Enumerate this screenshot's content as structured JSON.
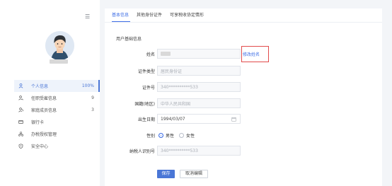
{
  "sidebar": {
    "items": [
      {
        "icon": "user-icon",
        "label": "个人信息",
        "count": "100%",
        "active": true
      },
      {
        "icon": "work-user-icon",
        "label": "任职受雇信息",
        "count": "9"
      },
      {
        "icon": "family-user-icon",
        "label": "家庭成员信息",
        "count": "3"
      },
      {
        "icon": "bank-card-icon",
        "label": "银行卡"
      },
      {
        "icon": "authorization-icon",
        "label": "办税授权管理"
      },
      {
        "icon": "security-shield-icon",
        "label": "安全中心"
      }
    ]
  },
  "tabs": [
    {
      "label": "基本信息",
      "active": true
    },
    {
      "label": "其他身份证件"
    },
    {
      "label": "可享税收协定情形"
    }
  ],
  "section_title": "用户基础信息",
  "form": {
    "name": {
      "label": "姓名"
    },
    "document_type": {
      "label": "证件类型",
      "value": "居民身份证"
    },
    "document_number": {
      "label": "证件号",
      "value": "340**********533"
    },
    "nationality": {
      "label": "国籍(地区)",
      "value": "中华人民共和国"
    },
    "birth_date": {
      "label": "出生日期",
      "value": "1994/03/07"
    },
    "gender": {
      "label": "性别",
      "options": [
        "男性",
        "女性"
      ],
      "selected": "男性"
    },
    "taxpayer_id": {
      "label": "纳税人识别号",
      "value": "340**********533"
    }
  },
  "modify_link": "修改姓名",
  "actions": {
    "save": "保存",
    "cancel": "取消编辑"
  },
  "colors": {
    "accent": "#4a76d6",
    "highlight": "#e24b4b",
    "avatar_bg": "#dfe8f3"
  }
}
